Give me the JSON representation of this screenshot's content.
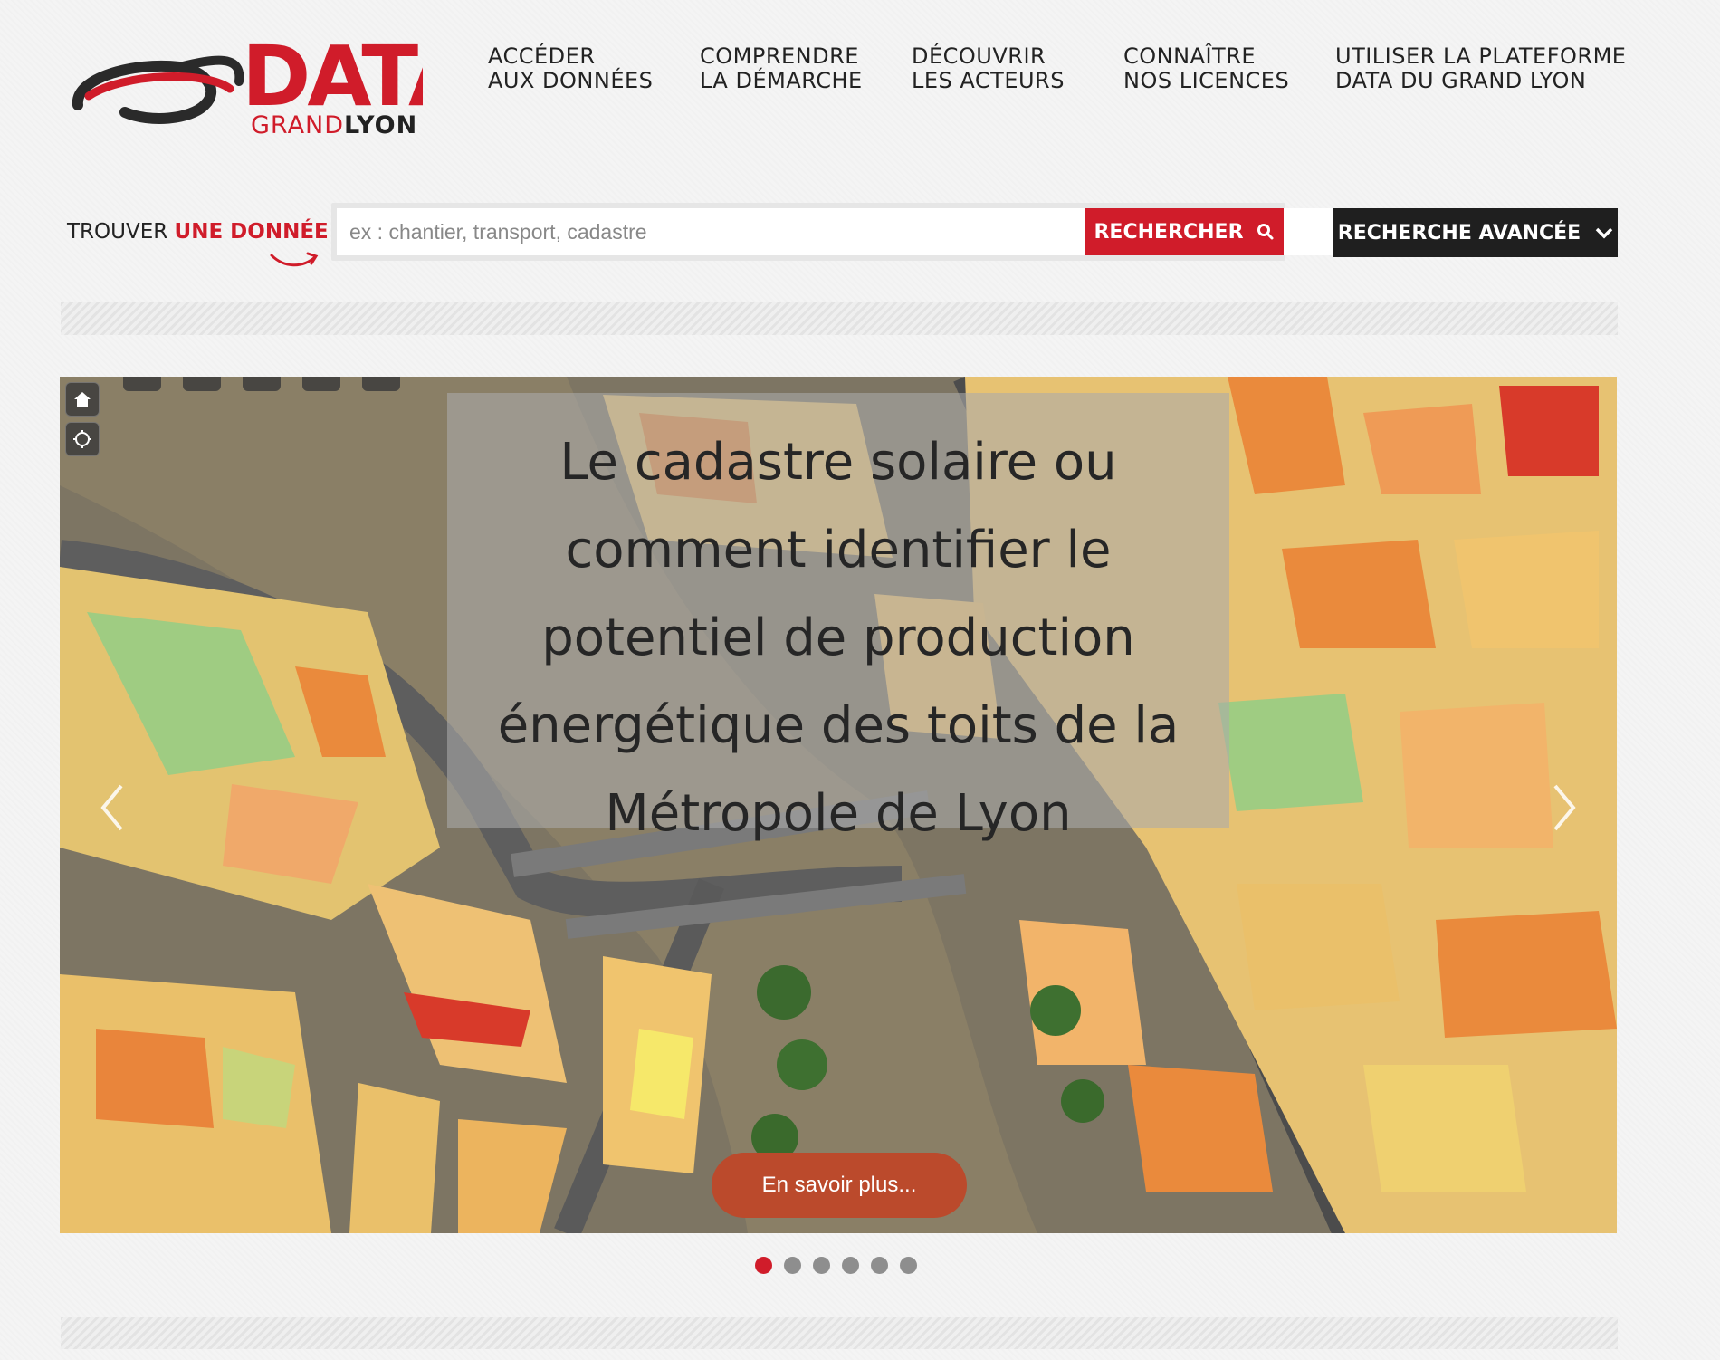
{
  "logo": {
    "data_text": "DATA",
    "grand": "GRAND",
    "lyon": "LYON"
  },
  "nav": [
    {
      "line1": "ACCÉDER",
      "line2": "AUX DONNÉES"
    },
    {
      "line1": "COMPRENDRE",
      "line2": "LA DÉMARCHE"
    },
    {
      "line1": "DÉCOUVRIR",
      "line2": "LES ACTEURS"
    },
    {
      "line1": "CONNAÎTRE",
      "line2": "NOS LICENCES"
    },
    {
      "line1": "UTILISER LA PLATEFORME",
      "line2": "DATA DU GRAND LYON"
    }
  ],
  "search": {
    "label_prefix": "TROUVER",
    "label_accent": "UNE DONNÉE",
    "placeholder": "ex : chantier, transport, cadastre",
    "value": "",
    "button_label": "RECHERCHER",
    "advanced_label": "RECHERCHE AVANCÉE"
  },
  "hero": {
    "caption": "Le cadastre solaire ou\ncomment identifier le\npotentiel de production\nénergétique des toits de la\nMétropole de Lyon",
    "cta_label": "En savoir plus...",
    "slide_count": 6,
    "active_slide": 1
  },
  "icons": {
    "home": "home-icon",
    "locate": "locate-icon",
    "search": "search-icon",
    "chevron": "chevron-down-icon",
    "prev": "chevron-left-icon",
    "next": "chevron-right-icon"
  },
  "colors": {
    "brand_red": "#d01c2a",
    "dark": "#1f1f1f",
    "cta": "#bb4a2c",
    "dot_inactive": "#8e8e8e"
  }
}
